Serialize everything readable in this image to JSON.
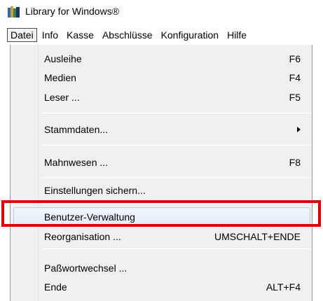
{
  "window": {
    "title": "Library for Windows®",
    "app_icon": "library-books-icon"
  },
  "menubar": {
    "items": [
      {
        "label": "Datei"
      },
      {
        "label": "Info"
      },
      {
        "label": "Kasse"
      },
      {
        "label": "Abschlüsse"
      },
      {
        "label": "Konfiguration"
      },
      {
        "label": "Hilfe"
      }
    ]
  },
  "datei_menu": {
    "items": [
      {
        "label": "Ausleihe",
        "shortcut": "F6"
      },
      {
        "label": "Medien",
        "shortcut": "F4"
      },
      {
        "label": "Leser ...",
        "shortcut": "F5"
      },
      {
        "label": "Stammdaten...",
        "shortcut": ""
      },
      {
        "label": "Mahnwesen ...",
        "shortcut": "F8"
      },
      {
        "label": "Einstellungen sichern...",
        "shortcut": ""
      },
      {
        "label": "Benutzer-Verwaltung",
        "shortcut": ""
      },
      {
        "label": "Reorganisation ...",
        "shortcut": "UMSCHALT+ENDE"
      },
      {
        "label": "Paßwortwechsel ...",
        "shortcut": ""
      },
      {
        "label": "Ende",
        "shortcut": "ALT+F4"
      }
    ],
    "highlighted": "Benutzer-Verwaltung",
    "highlight_color": "#e00000",
    "submenu_arrow_icon": "chevron-right-icon"
  }
}
